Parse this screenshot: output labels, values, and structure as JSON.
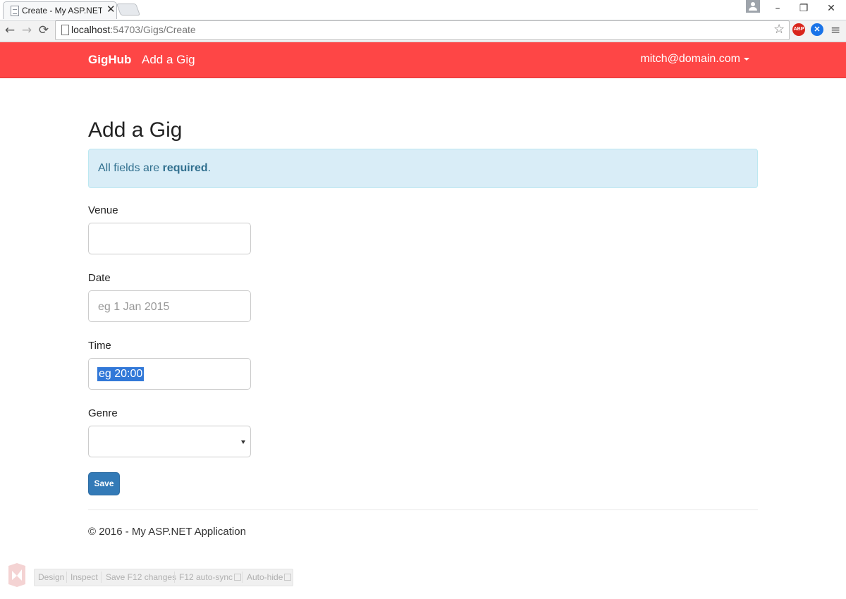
{
  "browser": {
    "tab_title": "Create - My ASP.NET App",
    "tab_close": "✕",
    "url_host": "localhost",
    "url_path": ":54703/Gigs/Create",
    "icons": {
      "back": "←",
      "forward": "→",
      "reload": "⟳",
      "bookmark": "☆",
      "adblock": "ABP",
      "extension": "✕",
      "menu": "≡",
      "minimize": "–",
      "restore": "❐",
      "close": "✕"
    }
  },
  "navbar": {
    "brand": "GigHub",
    "link": "Add a Gig",
    "user": "mitch@domain.com",
    "bg_color": "#fe4646"
  },
  "page": {
    "title": "Add a Gig",
    "alert_prefix": "All fields are ",
    "alert_bold": "required",
    "alert_suffix": "."
  },
  "form": {
    "venue": {
      "label": "Venue",
      "value": ""
    },
    "date": {
      "label": "Date",
      "placeholder": "eg 1 Jan 2015"
    },
    "time": {
      "label": "Time",
      "placeholder": "eg 20:00"
    },
    "genre": {
      "label": "Genre",
      "selected": ""
    },
    "save_label": "Save"
  },
  "footer": {
    "text": "© 2016 - My ASP.NET Application"
  },
  "browser_link": {
    "design": "Design",
    "inspect": "Inspect",
    "save_f12": "Save F12 changes",
    "auto_sync": "F12 auto-sync",
    "auto_hide": "Auto-hide"
  }
}
